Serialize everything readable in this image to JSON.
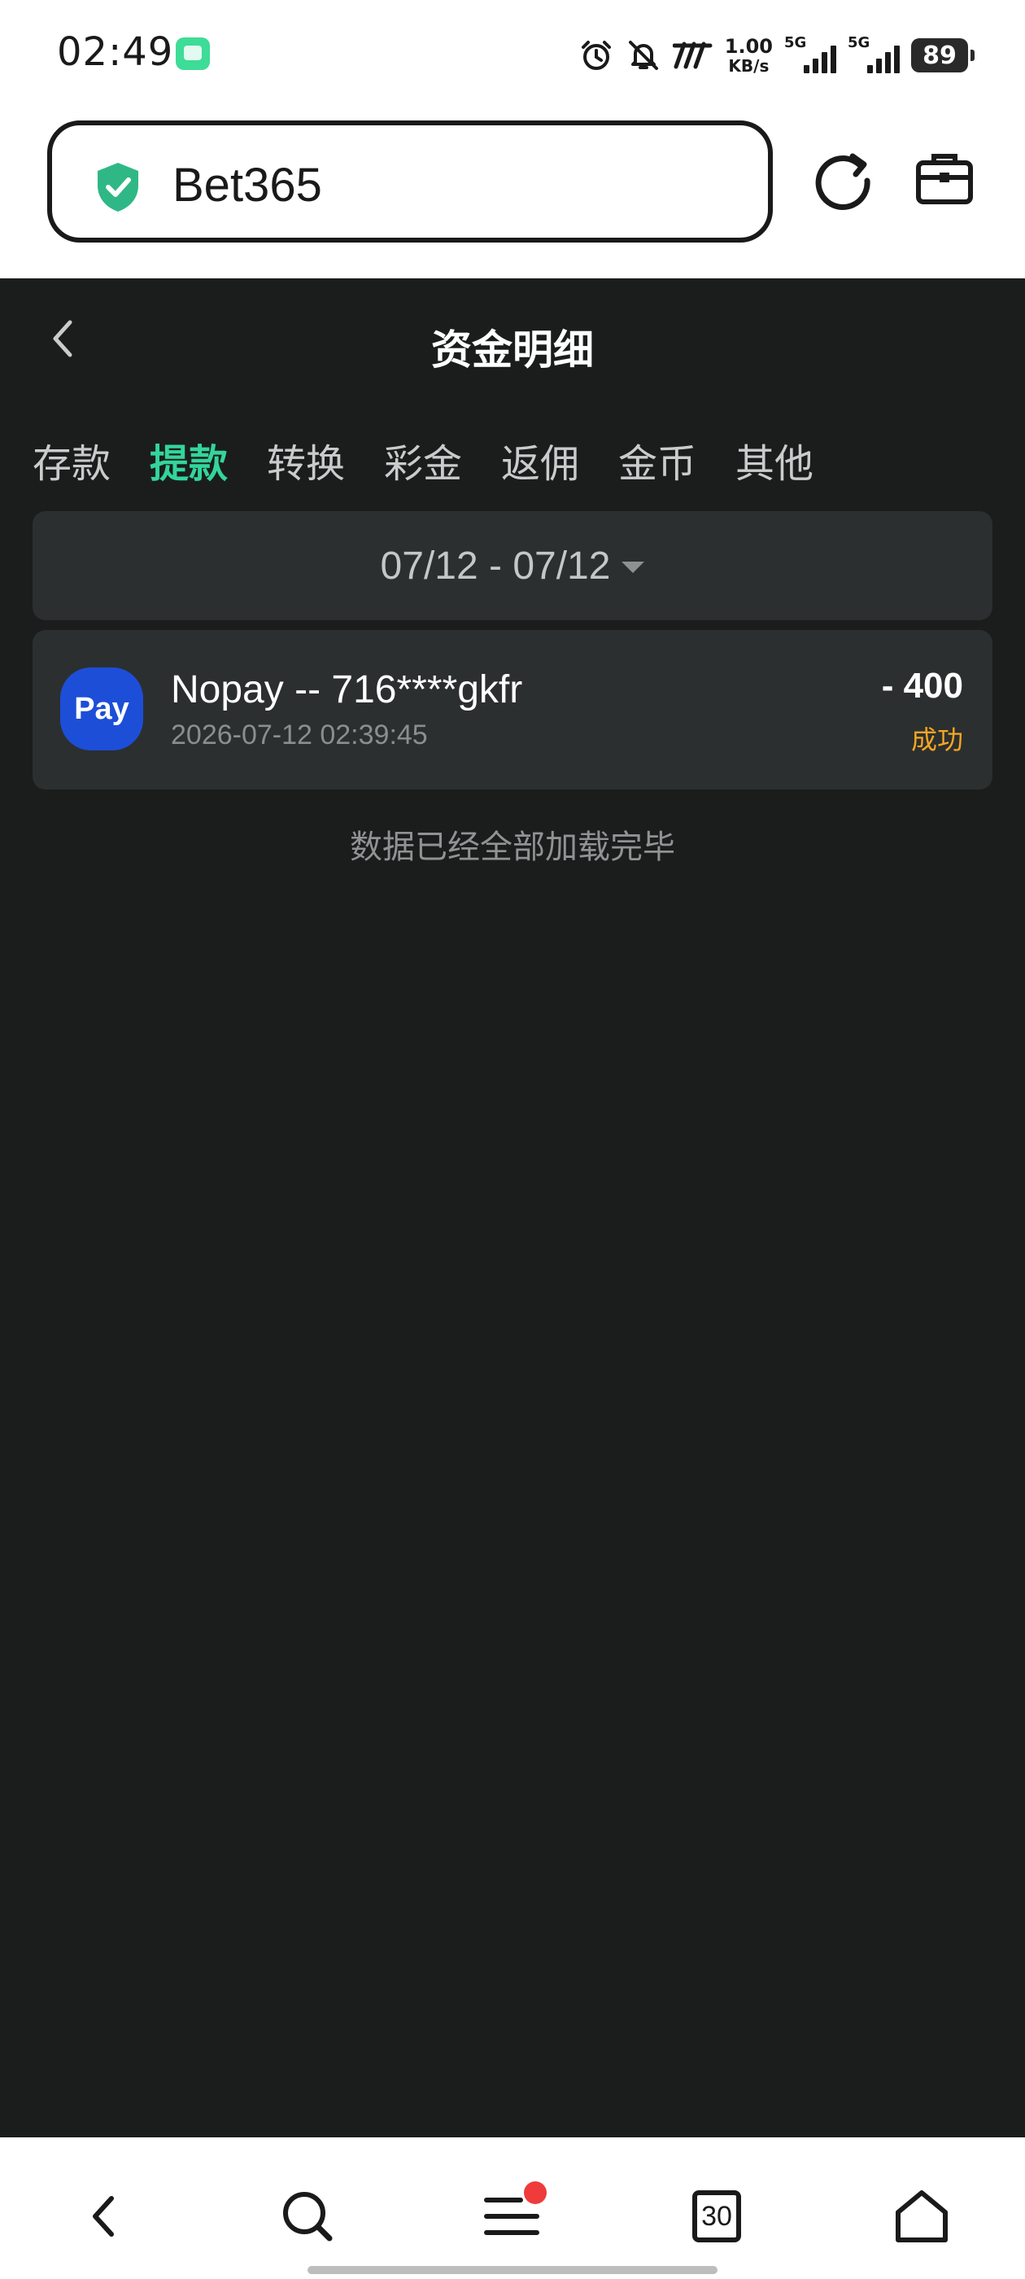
{
  "status_bar": {
    "time": "02:49",
    "net_speed_value": "1.00",
    "net_speed_unit": "KB/s",
    "signal_1": "5G",
    "signal_2": "5G",
    "battery": "89"
  },
  "browser": {
    "url_text": "Bet365"
  },
  "header": {
    "title": "资金明细"
  },
  "tabs": [
    {
      "label": "存款",
      "active": false
    },
    {
      "label": "提款",
      "active": true
    },
    {
      "label": "转换",
      "active": false
    },
    {
      "label": "彩金",
      "active": false
    },
    {
      "label": "返佣",
      "active": false
    },
    {
      "label": "金币",
      "active": false
    },
    {
      "label": "其他",
      "active": false
    }
  ],
  "date_filter": {
    "range": "07/12 - 07/12"
  },
  "transactions": [
    {
      "logo_text": "Pay",
      "name": "Nopay -- 716****gkfr",
      "datetime": "2026-07-12 02:39:45",
      "amount": "- 400",
      "status": "成功"
    }
  ],
  "footer_text": "数据已经全部加载完毕",
  "bottom_nav": {
    "tab_count": "30"
  },
  "colors": {
    "background": "#1b1d1d",
    "card": "#2c2f2f",
    "accent": "#33d59c",
    "status_success": "#f5a623",
    "pay_logo": "#1d4ed8",
    "badge_dot": "#ef3b3b"
  }
}
